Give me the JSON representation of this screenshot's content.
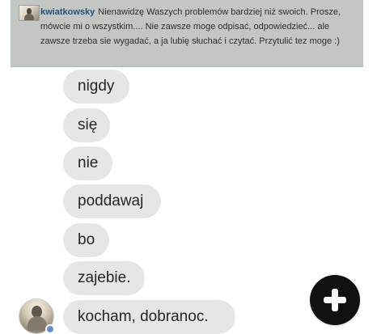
{
  "profile_banner": {
    "avatar_icon": "profile-photo",
    "username": "kwiatkowsky",
    "bio": "Nienawidzę Waszych problemów bardziej niż swoich. Prosze, mówcie mi o wszystkim.... Nie zawsze moge odpisać, odpowiedzieć... ale zawsze trzeba sie wygadać, a ja lubię słuchać i czytać. Przytulić tez moge :)"
  },
  "chat": {
    "messages": [
      {
        "text": "nigdy"
      },
      {
        "text": "się"
      },
      {
        "text": "nie"
      },
      {
        "text": "poddawaj"
      },
      {
        "text": "bo"
      },
      {
        "text": "zajebie."
      },
      {
        "text": "kocham, dobranoc."
      }
    ],
    "sender_avatar_icon": "profile-photo",
    "badge_icon": "messenger-badge"
  },
  "fab": {
    "icon": "plus-icon"
  },
  "colors": {
    "banner_background": "#c2c7c3",
    "bubble_background": "#e6e6e6",
    "bubble_text": "#262626",
    "username": "#2a4f7a",
    "fab_background": "#101010"
  }
}
